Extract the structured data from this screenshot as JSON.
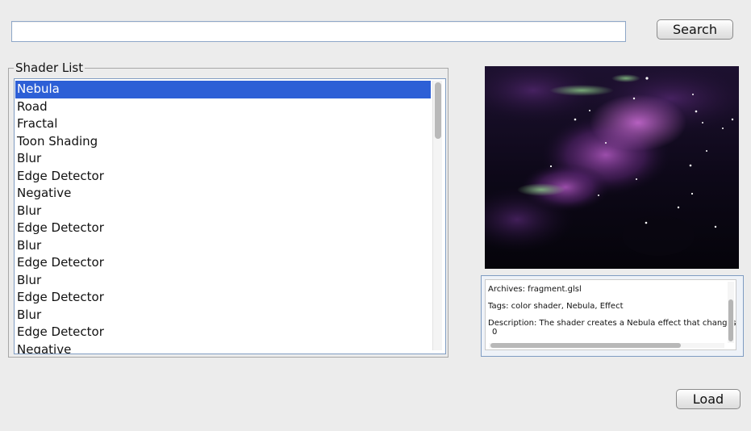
{
  "search": {
    "value": "",
    "button_label": "Search"
  },
  "shader_list": {
    "title": "Shader List",
    "selected_index": 0,
    "items": [
      "Nebula",
      "Road",
      "Fractal",
      "Toon Shading",
      "Blur",
      "Edge Detector",
      "Negative",
      "Blur",
      "Edge Detector",
      "Blur",
      "Edge Detector",
      "Blur",
      "Edge Detector",
      "Blur",
      "Edge Detector",
      "Negative"
    ]
  },
  "preview": {
    "image": "nebula-shader-preview"
  },
  "info": {
    "archives": "Archives: fragment.glsl",
    "tags": "Tags: color shader, Nebula, Effect",
    "description": "Description: The shader creates a Nebula effect that changes",
    "description_cont": "0"
  },
  "load_button_label": "Load",
  "colors": {
    "selection": "#2d5fd6",
    "focus_border": "#7f9cc2",
    "background": "#ececec"
  }
}
